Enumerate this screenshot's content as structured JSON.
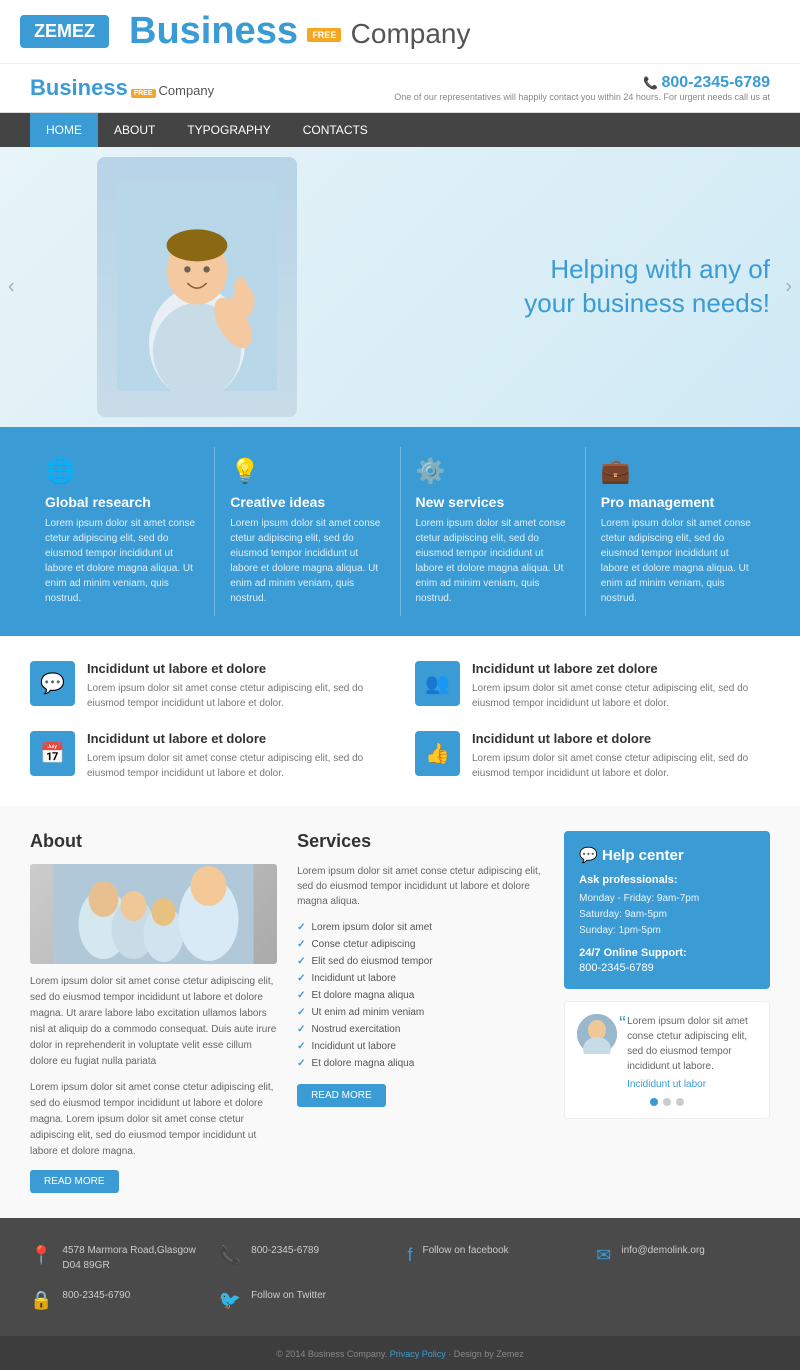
{
  "topBanner": {
    "zemez": "ZEMEZ",
    "business": "Business",
    "free": "FREE",
    "company": "Company"
  },
  "header": {
    "logoText": "Business",
    "logoFree": "FREE",
    "logoCompany": "Company",
    "phone": "800-2345-6789",
    "tagline": "One of our representatives will happily contact you within 24 hours. For urgent needs call us at"
  },
  "nav": {
    "items": [
      {
        "label": "HOME",
        "active": true
      },
      {
        "label": "ABOUT",
        "active": false
      },
      {
        "label": "TYPOGRAPHY",
        "active": false
      },
      {
        "label": "CONTACTS",
        "active": false
      }
    ]
  },
  "hero": {
    "tagline": "Helping with any of\nyour business needs!"
  },
  "features": [
    {
      "icon": "🌐",
      "title": "Global research",
      "desc": "Lorem ipsum dolor sit amet conse ctetur adipiscing elit, sed do eiusmod tempor incididunt ut labore et dolore magna aliqua. Ut enim ad minim veniam, quis nostrud."
    },
    {
      "icon": "💡",
      "title": "Creative ideas",
      "desc": "Lorem ipsum dolor sit amet conse ctetur adipiscing elit, sed do eiusmod tempor incididunt ut labore et dolore magna aliqua. Ut enim ad minim veniam, quis nostrud."
    },
    {
      "icon": "⚙️",
      "title": "New services",
      "desc": "Lorem ipsum dolor sit amet conse ctetur adipiscing elit, sed do eiusmod tempor incididunt ut labore et dolore magna aliqua. Ut enim ad minim veniam, quis nostrud."
    },
    {
      "icon": "💼",
      "title": "Pro management",
      "desc": "Lorem ipsum dolor sit amet conse ctetur adipiscing elit, sed do eiusmod tempor incididunt ut labore et dolore magna aliqua. Ut enim ad minim veniam, quis nostrud."
    }
  ],
  "infoBoxes": [
    {
      "icon": "💬",
      "title": "Incididunt ut labore et dolore",
      "desc": "Lorem ipsum dolor sit amet conse ctetur adipiscing elit, sed do eiusmod tempor incididunt ut labore et dolor."
    },
    {
      "icon": "👥",
      "title": "Incididunt ut labore zet dolore",
      "desc": "Lorem ipsum dolor sit amet conse ctetur adipiscing elit, sed do eiusmod tempor incididunt ut labore et dolor."
    },
    {
      "icon": "📅",
      "title": "Incididunt ut labore et dolore",
      "desc": "Lorem ipsum dolor sit amet conse ctetur adipiscing elit, sed do eiusmod tempor incididunt ut labore et dolor."
    },
    {
      "icon": "👍",
      "title": "Incididunt ut labore et dolore",
      "desc": "Lorem ipsum dolor sit amet conse ctetur adipiscing elit, sed do eiusmod tempor incididunt ut labore et dolor."
    }
  ],
  "about": {
    "title": "About",
    "text1": "Lorem ipsum dolor sit amet conse ctetur adipiscing elit, sed do eiusmod tempor incididunt ut labore et dolore magna. Ut arare labore labo excitation ullamos labors nisl at aliquip do a commodo consequat. Duis aute irure dolor in reprehenderit in voluptate velit esse cillum dolore eu fugiat nulla pariata",
    "text2": "Lorem ipsum dolor sit amet conse ctetur adipiscing elit, sed do eiusmod tempor incididunt ut labore et dolore magna. Lorem ipsum dolor sit amet conse ctetur adipiscing elit, sed do eiusmod tempor incididunt ut labore et dolore magna.",
    "readMore": "READ MORE"
  },
  "services": {
    "title": "Services",
    "desc": "Lorem ipsum dolor sit amet conse ctetur adipiscing elit, sed do eiusmod tempor incididunt ut labore et dolore magna aliqua.",
    "list": [
      "Lorem ipsum dolor sit amet",
      "Conse ctetur adipiscing",
      "Elit sed do eiusmod tempor",
      "Incididunt ut labore",
      "Et dolore magna aliqua",
      "Ut enim ad minim veniam",
      "Nostrud exercitation",
      "Incididunt ut labore",
      "Et dolore magna aliqua"
    ],
    "readMore": "READ MORE"
  },
  "help": {
    "title": "Help center",
    "askTitle": "Ask professionals:",
    "hours": "Monday - Friday: 9am-7pm\nSaturday: 9am-5pm\nSunday: 1pm-5pm",
    "supportTitle": "24/7 Online Support:",
    "phone": "800-2345-6789",
    "testimonialText": "Lorem ipsum dolor sit amet conse ctetur adipiscing elit, sed do eiusmod tempor incididunt ut labore.",
    "testimonialLink": "Incididunt ut labor"
  },
  "footer": {
    "address": "4578 Marmora Road,Glasgow D04 89GR",
    "phone1": "800-2345-6789",
    "facebook": "Follow on facebook",
    "email": "info@demolink.org",
    "phone2": "800-2345-6790",
    "twitter": "Follow on Twitter",
    "copyright": "© 2014 Business Company.",
    "privacyPolicy": "Privacy Policy",
    "design": "Design by Zemez"
  }
}
